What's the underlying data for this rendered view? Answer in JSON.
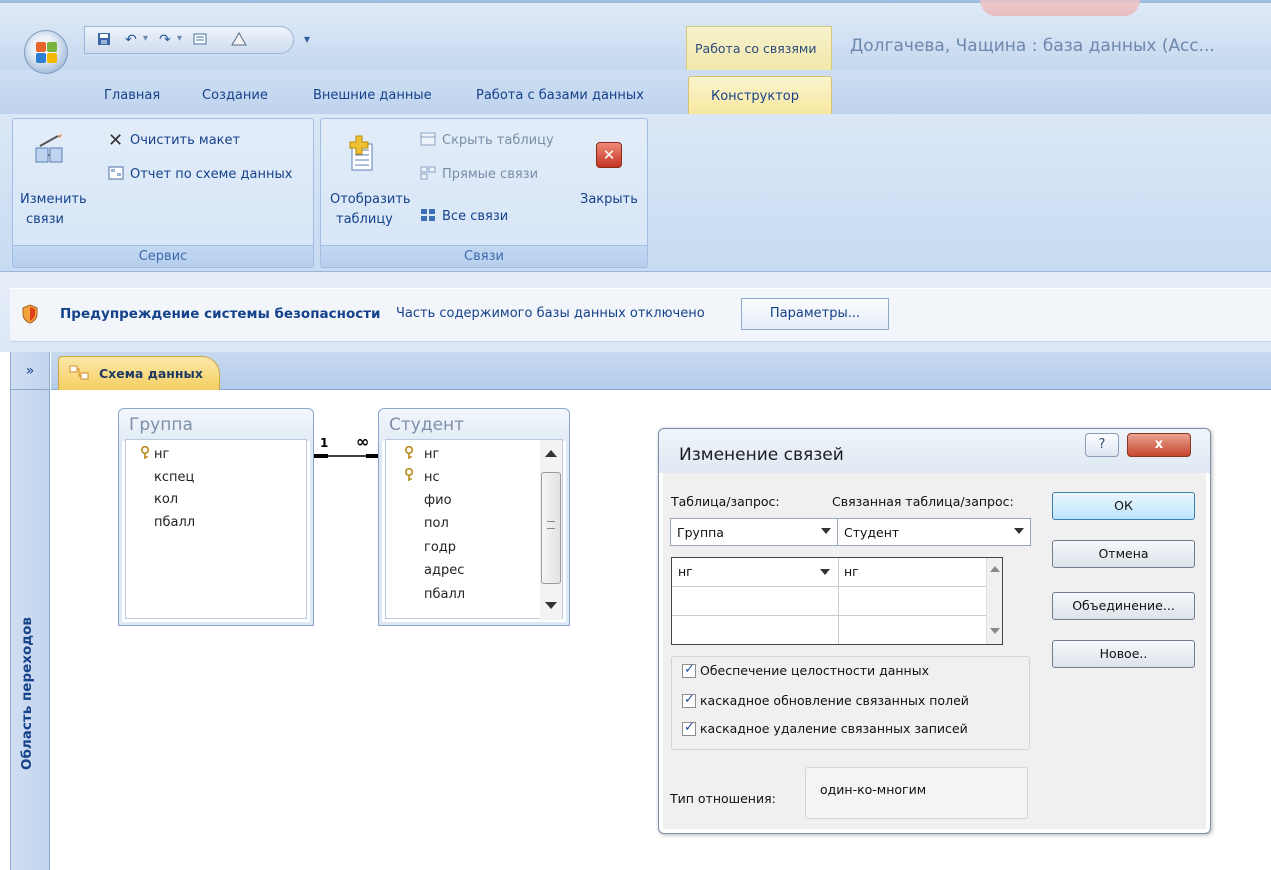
{
  "window": {
    "context_tab_group": "Работа со связями",
    "app_title": "Долгачева, Чащина : база данных (Acc..."
  },
  "ribbon_tabs": [
    {
      "label": "Главная"
    },
    {
      "label": "Создание"
    },
    {
      "label": "Внешние данные"
    },
    {
      "label": "Работа с базами данных"
    },
    {
      "label": "Конструктор",
      "active": true
    }
  ],
  "ribbon": {
    "service_group": {
      "label": "Сервис",
      "edit_relations_line1": "Изменить",
      "edit_relations_line2": "связи",
      "clear_layout": "Очистить макет",
      "schema_report": "Отчет по схеме данных"
    },
    "relations_group": {
      "label": "Связи",
      "show_table_line1": "Отобразить",
      "show_table_line2": "таблицу",
      "hide_table": "Скрыть таблицу",
      "direct_relations": "Прямые связи",
      "all_relations": "Все связи",
      "close": "Закрыть"
    }
  },
  "security_bar": {
    "title": "Предупреждение системы безопасности",
    "message": "Часть содержимого базы данных отключено",
    "button": "Параметры..."
  },
  "nav_pane": {
    "toggle": "»",
    "label": "Область переходов"
  },
  "document_tab": {
    "label": "Схема данных"
  },
  "relationship": {
    "one_label": "1",
    "many_label": "∞"
  },
  "tables": {
    "group": {
      "title": "Группа",
      "fields": [
        "нг",
        "кспец",
        "кол",
        "пбалл"
      ],
      "key_fields": [
        "нг"
      ]
    },
    "student": {
      "title": "Студент",
      "fields": [
        "нг",
        "нс",
        "фио",
        "пол",
        "годр",
        "адрес",
        "пбалл"
      ],
      "key_fields": [
        "нг",
        "нс"
      ]
    }
  },
  "dialog": {
    "title": "Изменение связей",
    "help_button": "?",
    "close_button": "x",
    "table_label": "Таблица/запрос:",
    "related_label": "Связанная таблица/запрос:",
    "table_value": "Группа",
    "related_value": "Студент",
    "grid_left": "нг",
    "grid_right": "нг",
    "buttons": {
      "ok": "ОК",
      "cancel": "Отмена",
      "join": "Объединение...",
      "new": "Новое.."
    },
    "checkboxes": {
      "integrity": "Обеспечение целостности данных",
      "cascade_update": "каскадное обновление связанных полей",
      "cascade_delete": "каскадное удаление связанных записей"
    },
    "relation_type_label": "Тип отношения:",
    "relation_type_value": "один-ко-многим"
  },
  "colors": {
    "ribbon_blue": "#c7dbf2",
    "text_blue": "#15428b",
    "context_yellow": "#f6e79c"
  }
}
